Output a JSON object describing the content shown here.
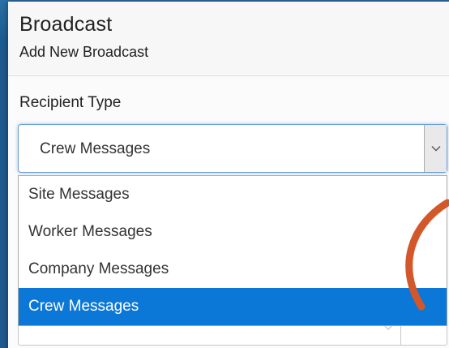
{
  "header": {
    "title": "Broadcast",
    "subtitle": "Add New Broadcast"
  },
  "form": {
    "recipient_type_label": "Recipient Type",
    "recipient_type_value": "Crew Messages",
    "options": [
      {
        "label": "Site Messages",
        "selected": false
      },
      {
        "label": "Worker Messages",
        "selected": false
      },
      {
        "label": "Company Messages",
        "selected": false
      },
      {
        "label": "Crew Messages",
        "selected": true
      }
    ]
  },
  "icons": {
    "select_arrow": "chevron-down-icon",
    "under_arrow": "chevron-down-icon"
  },
  "colors": {
    "selected_option_bg": "#0b77d6",
    "annotation_stroke": "#d2582a",
    "focus_border": "#6a9fd8"
  }
}
